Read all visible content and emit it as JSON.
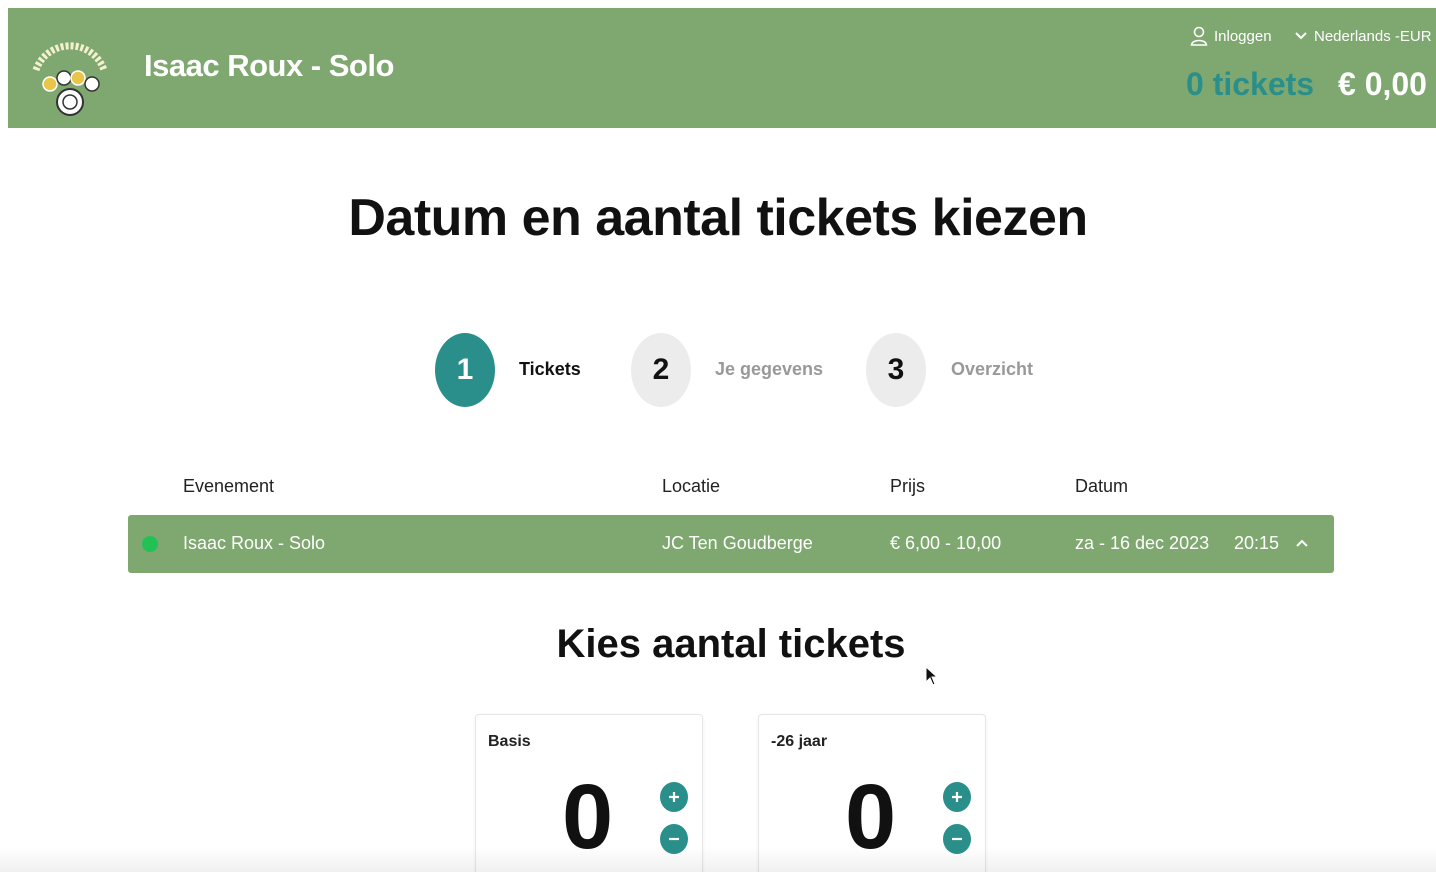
{
  "header": {
    "title": "Isaac Roux - Solo",
    "logo_icon": "cultuurseizoen-logo",
    "login_label": "Inloggen",
    "language_label": "Nederlands -EUR",
    "cart_tickets": "0 tickets",
    "cart_total": "€ 0,00",
    "colors": {
      "header_bg": "#7ea86f",
      "accent": "#2a8f8a"
    }
  },
  "page": {
    "title": "Datum en aantal tickets kiezen"
  },
  "steps": [
    {
      "number": "1",
      "label": "Tickets",
      "active": true
    },
    {
      "number": "2",
      "label": "Je gegevens",
      "active": false
    },
    {
      "number": "3",
      "label": "Overzicht",
      "active": false
    }
  ],
  "table": {
    "headers": {
      "event": "Evenement",
      "location": "Locatie",
      "price": "Prijs",
      "date": "Datum"
    },
    "row": {
      "status_color": "#22c155",
      "event": "Isaac Roux - Solo",
      "location": "JC Ten Goudberge",
      "price": "€ 6,00 - 10,00",
      "date": "za - 16 dec 2023",
      "time": "20:15"
    }
  },
  "ticket_section": {
    "title": "Kies aantal tickets",
    "types": [
      {
        "label": "Basis",
        "count": "0"
      },
      {
        "label": "-26 jaar",
        "count": "0"
      }
    ]
  }
}
